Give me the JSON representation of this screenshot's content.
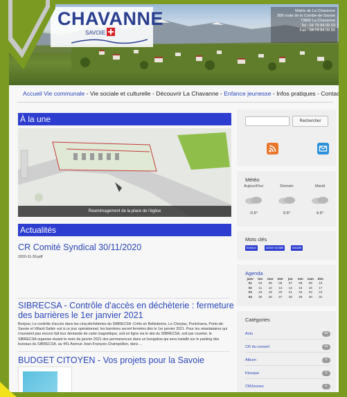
{
  "header": {
    "logo_title": "CHAVANNE",
    "logo_subtitle": "SAVOIE",
    "address_lines": [
      "Mairie de La Chavanne",
      "308 route de la Combe-de-Savoie",
      "73800 La Chavanne",
      "Tel : 04 79 84 09 03",
      "Fax : 04 79 84 09 80"
    ]
  },
  "nav": {
    "items": [
      {
        "label": "Accueil",
        "style": "blue"
      },
      {
        "label": "Vie communale",
        "style": "blue"
      },
      {
        "label": "-",
        "style": "sep"
      },
      {
        "label": "Vie sociale et culturelle",
        "style": "dark"
      },
      {
        "label": "-",
        "style": "sep"
      },
      {
        "label": "Découvrir La Chavanne",
        "style": "dark"
      },
      {
        "label": "-",
        "style": "sep"
      },
      {
        "label": "Enfance jeunesse",
        "style": "blue"
      },
      {
        "label": "-",
        "style": "sep"
      },
      {
        "label": "Infos pratiques",
        "style": "dark"
      },
      {
        "label": "-",
        "style": "sep"
      },
      {
        "label": "Contact",
        "style": "dark"
      }
    ]
  },
  "main": {
    "a_la_une_title": "À la une",
    "slide_caption": "Réaménagement de la place de l'église",
    "actualites_title": "Actualités",
    "articles": [
      {
        "title": "CR Comité Syndical 30/11/2020",
        "text": "2020-11-30.pdf"
      },
      {
        "title": "SIBRECSA - Contrôle d'accès en déchèterie : fermeture des barrières le 1er janvier 2021",
        "text": "Bonjour,   Le contrôle d'accès dans les cinq déchèteries du SIBRECSA -Crêts en Belledonne, Le Cheylas, Pontcharra, Porte-de-Savoie et Villard-Sallet- est à ce jour opérationnel, les barrières seront fermées dès le 1er janvier 2021. Pour les retardataires qui n'auraient pas encore fait leur demande de carte magnétique, soit en ligne via le site du SIBRECSA, soit par courrier, le SIBRECSA organise durant le mois de janvier 2021 des permanences dans un bungalow qui sera installé sur le parking des bureaux du SIBRECSA, au 441 Avenue Jean-François Champollion, dans ..."
      },
      {
        "title": "BUDGET CITOYEN - Vos projets pour la Savoie",
        "text": ""
      }
    ]
  },
  "sidebar": {
    "search_button": "Rechercher",
    "search_placeholder": "",
    "meteo_title": "Météo",
    "meteo_days": [
      {
        "day": "Aujourd'hui",
        "temp": "-0.5°"
      },
      {
        "day": "Demain",
        "temp": "0.5°"
      },
      {
        "day": "Mardi",
        "temp": "4.5°"
      }
    ],
    "mots_cles_title": "Mots clés",
    "tags": [
      "travaux",
      "action sociale",
      "sociale"
    ],
    "agenda_title": "Agenda",
    "agenda_month": "janv",
    "agenda_header": [
      "lun",
      "mar",
      "mer",
      "jeu",
      "ven",
      "sam",
      "dim"
    ],
    "agenda_weeks": [
      {
        "wk": "01",
        "days": [
          "04",
          "05",
          "06",
          "07",
          "08",
          "09",
          "10"
        ]
      },
      {
        "wk": "02",
        "days": [
          "11",
          "12",
          "13",
          "14",
          "15",
          "16",
          "17"
        ]
      },
      {
        "wk": "03",
        "days": [
          "18",
          "19",
          "20",
          "21",
          "22",
          "23",
          "24"
        ]
      },
      {
        "wk": "04",
        "days": [
          "25",
          "26",
          "27",
          "28",
          "29",
          "30",
          "31"
        ]
      }
    ],
    "categories_title": "Catégories",
    "categories": [
      {
        "label": "Actu",
        "count": "90"
      },
      {
        "label": "CR du conseil",
        "count": "31"
      },
      {
        "label": "Album",
        "count": "2"
      },
      {
        "label": "Kiosque",
        "count": "5"
      },
      {
        "label": "CMJeunes",
        "count": "5"
      }
    ]
  }
}
